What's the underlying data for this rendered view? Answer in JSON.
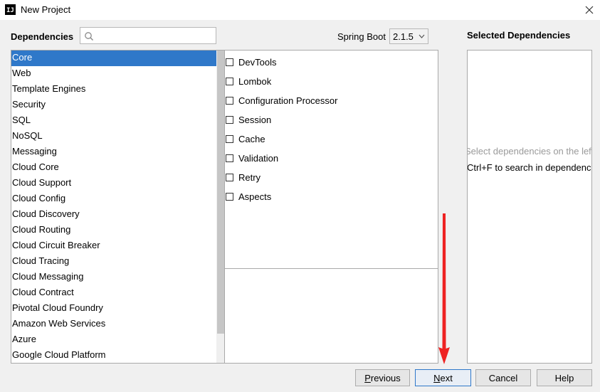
{
  "window": {
    "title": "New Project",
    "icon_text": "IJ"
  },
  "header": {
    "dependencies_label": "Dependencies",
    "search": {
      "value": "",
      "placeholder": ""
    },
    "spring_boot_label": "Spring Boot",
    "spring_boot_version": "2.1.5"
  },
  "categories": [
    "Core",
    "Web",
    "Template Engines",
    "Security",
    "SQL",
    "NoSQL",
    "Messaging",
    "Cloud Core",
    "Cloud Support",
    "Cloud Config",
    "Cloud Discovery",
    "Cloud Routing",
    "Cloud Circuit Breaker",
    "Cloud Tracing",
    "Cloud Messaging",
    "Cloud Contract",
    "Pivotal Cloud Foundry",
    "Amazon Web Services",
    "Azure",
    "Google Cloud Platform"
  ],
  "selected_category": "Core",
  "dependencies": [
    {
      "label": "DevTools",
      "checked": false
    },
    {
      "label": "Lombok",
      "checked": false
    },
    {
      "label": "Configuration Processor",
      "checked": false
    },
    {
      "label": "Session",
      "checked": false
    },
    {
      "label": "Cache",
      "checked": false
    },
    {
      "label": "Validation",
      "checked": false
    },
    {
      "label": "Retry",
      "checked": false
    },
    {
      "label": "Aspects",
      "checked": false
    }
  ],
  "selected_dependencies": {
    "title": "Selected Dependencies",
    "hint_line1": "Select dependencies on the left",
    "hint_line2": "Ctrl+F to search in dependencies"
  },
  "buttons": {
    "previous": {
      "mnemonic": "P",
      "rest": "revious"
    },
    "next": {
      "mnemonic": "N",
      "rest": "ext"
    },
    "cancel": "Cancel",
    "help": "Help"
  },
  "colors": {
    "selection": "#2f78c9",
    "arrow": "#ee2222"
  },
  "icons": [
    "app-icon",
    "search-icon",
    "close-icon",
    "chevron-down-icon"
  ]
}
